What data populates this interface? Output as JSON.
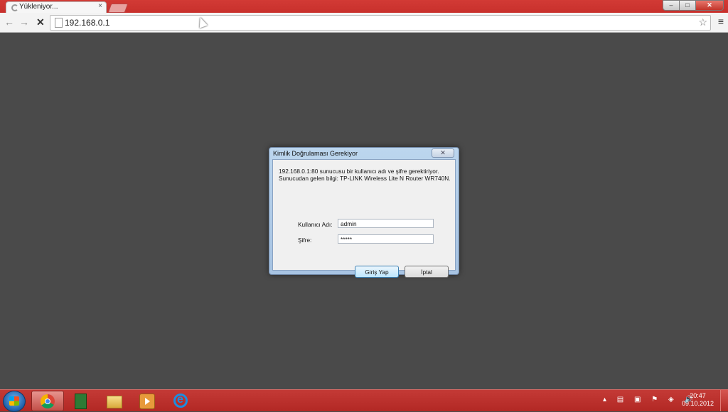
{
  "browser": {
    "tab_title": "Yükleniyor...",
    "tab_close": "×",
    "url": "192.168.0.1",
    "back": "←",
    "forward": "→",
    "stop": "✕",
    "bookmark_star": "☆",
    "menu": "≡",
    "window_buttons": {
      "minimize": "–",
      "maximize": "□",
      "close": "✕"
    }
  },
  "dialog": {
    "title": "Kimlik Doğrulaması Gerekiyor",
    "close": "✕",
    "message": "192.168.0.1:80 sunucusu bir kullanıcı adı ve şifre gerektiriyor. Sunucudan gelen bilgi: TP-LINK Wireless Lite N Router WR740N.",
    "username_label": "Kullanıcı Adı:",
    "username_value": "admin",
    "password_label": "Şifre:",
    "password_value": "*****",
    "login_button": "Giriş Yap",
    "cancel_button": "İptal"
  },
  "taskbar": {
    "tray_icons": "▴ ▤ ▣ ⚑ ◈ 🔊",
    "time": "20:47",
    "date": "09.10.2012"
  }
}
